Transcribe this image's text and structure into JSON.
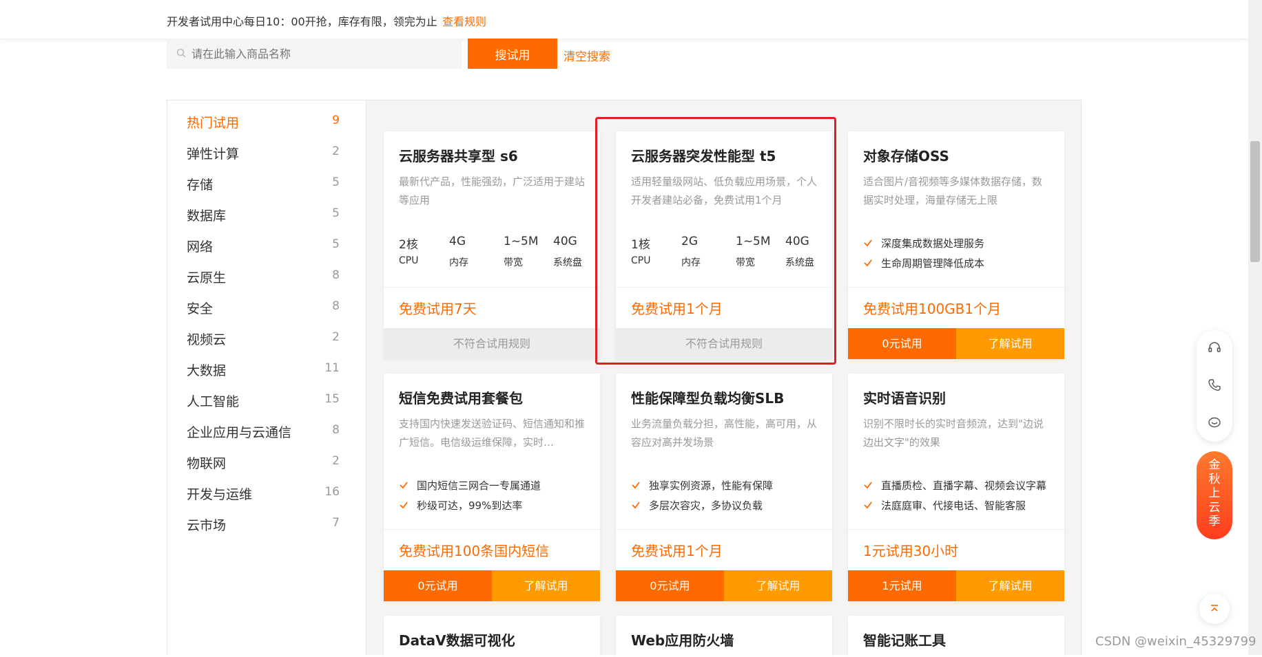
{
  "header": {
    "notice": "开发者试用中心每日10：00开抢，库存有限，领完为止",
    "rules_link": "查看规则"
  },
  "search": {
    "placeholder": "请在此输入商品名称",
    "button": "搜试用",
    "clear": "清空搜索"
  },
  "sidebar": {
    "items": [
      {
        "label": "热门试用",
        "count": "9"
      },
      {
        "label": "弹性计算",
        "count": "2"
      },
      {
        "label": "存储",
        "count": "5"
      },
      {
        "label": "数据库",
        "count": "5"
      },
      {
        "label": "网络",
        "count": "5"
      },
      {
        "label": "云原生",
        "count": "8"
      },
      {
        "label": "安全",
        "count": "8"
      },
      {
        "label": "视频云",
        "count": "2"
      },
      {
        "label": "大数据",
        "count": "11"
      },
      {
        "label": "人工智能",
        "count": "15"
      },
      {
        "label": "企业应用与云通信",
        "count": "8"
      },
      {
        "label": "物联网",
        "count": "2"
      },
      {
        "label": "开发与运维",
        "count": "16"
      },
      {
        "label": "云市场",
        "count": "7"
      }
    ]
  },
  "cards": [
    {
      "title": "云服务器共享型 s6",
      "desc": "最新代产品，性能强劲，广泛适用于建站等应用",
      "specs": [
        {
          "value": "2核",
          "unit": "CPU"
        },
        {
          "value": "4G",
          "unit": "内存"
        },
        {
          "value": "1~5M",
          "unit": "带宽"
        },
        {
          "value": "40G",
          "unit": "系统盘"
        }
      ],
      "offer": "免费试用7天",
      "disabled_label": "不符合试用规则"
    },
    {
      "title": "云服务器突发性能型 t5",
      "desc": "适用轻量级网站、低负载应用场景，个人开发者建站必备，免费试用1个月",
      "specs": [
        {
          "value": "1核",
          "unit": "CPU"
        },
        {
          "value": "2G",
          "unit": "内存"
        },
        {
          "value": "1~5M",
          "unit": "带宽"
        },
        {
          "value": "40G",
          "unit": "系统盘"
        }
      ],
      "offer": "免费试用1个月",
      "disabled_label": "不符合试用规则"
    },
    {
      "title": "对象存储OSS",
      "desc": "适合图片/音视频等多媒体数据存储，数据实时处理，海量存储无上限",
      "features": [
        "深度集成数据处理服务",
        "生命周期管理降低成本"
      ],
      "offer": "免费试用100GB1个月",
      "btn_primary": "0元试用",
      "btn_secondary": "了解试用"
    },
    {
      "title": "短信免费试用套餐包",
      "desc": "支持国内快速发送验证码、短信通知和推广短信。电信级运维保障，实时…",
      "features": [
        "国内短信三网合一专属通道",
        "秒级可达，99%到达率"
      ],
      "offer": "免费试用100条国内短信",
      "btn_primary": "0元试用",
      "btn_secondary": "了解试用"
    },
    {
      "title": "性能保障型负载均衡SLB",
      "desc": "业务流量负载分担，高性能，高可用，从容应对高并发场景",
      "features": [
        "独享实例资源，性能有保障",
        "多层次容灾，多协议负载"
      ],
      "offer": "免费试用1个月",
      "btn_primary": "0元试用",
      "btn_secondary": "了解试用"
    },
    {
      "title": "实时语音识别",
      "desc": "识别不限时长的实时音频流，达到\"边说边出文字\"的效果",
      "features": [
        "直播质检、直播字幕、视频会议字幕",
        "法庭庭审、代接电话、智能客服"
      ],
      "offer": "1元试用30小时",
      "btn_primary": "1元试用",
      "btn_secondary": "了解试用"
    },
    {
      "title": "DataV数据可视化"
    },
    {
      "title": "Web应用防火墙"
    },
    {
      "title": "智能记账工具"
    }
  ],
  "float": {
    "promo_chars": [
      "金",
      "秋",
      "上",
      "云",
      "季"
    ]
  },
  "watermark": "CSDN @weixin_45329799",
  "colors": {
    "accent": "#ff6a00",
    "accent_light": "#ff9a00",
    "highlight_box": "#e02020"
  }
}
